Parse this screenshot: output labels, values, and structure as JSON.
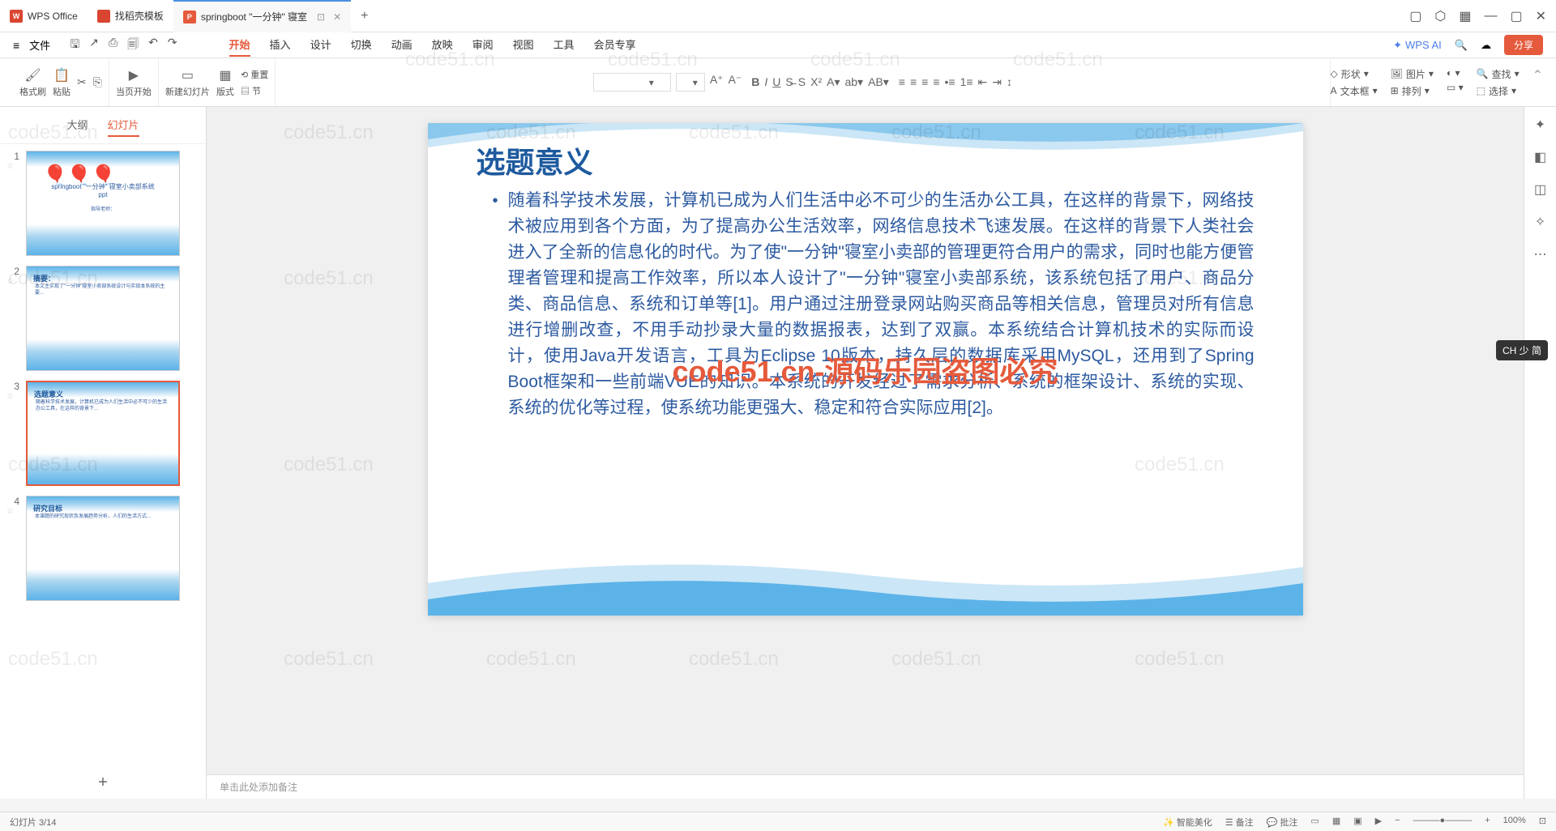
{
  "titlebar": {
    "tabs": [
      {
        "icon": "W",
        "label": "WPS Office"
      },
      {
        "icon": "D",
        "label": "找稻壳模板"
      },
      {
        "icon": "P",
        "label": "springboot \"一分钟\" 寝室"
      }
    ],
    "window_controls": {
      "min": "—",
      "max": "▢",
      "close": "✕"
    }
  },
  "menubar": {
    "file": "文件",
    "tabs": [
      "开始",
      "插入",
      "设计",
      "切换",
      "动画",
      "放映",
      "审阅",
      "视图",
      "工具",
      "会员专享"
    ],
    "active_tab": "开始",
    "wps_ai": "WPS AI",
    "share": "分享"
  },
  "ribbon": {
    "format_painter": "格式刷",
    "paste": "粘贴",
    "from_beginning": "当页开始",
    "new_slide": "新建幻灯片",
    "layout": "版式",
    "reset": "重置",
    "section": "节",
    "shape": "形状",
    "picture": "图片",
    "textbox": "文本框",
    "arrange": "排列",
    "find": "查找",
    "select": "选择"
  },
  "panel": {
    "tabs": {
      "outline": "大纲",
      "slides": "幻灯片"
    },
    "active": "幻灯片",
    "slides": [
      {
        "num": "1",
        "title": "springboot \"一分钟\" 寝室小卖部系统ppt",
        "subtitle": "指导老师："
      },
      {
        "num": "2",
        "title": "摘要："
      },
      {
        "num": "3",
        "title": "选题意义"
      },
      {
        "num": "4",
        "title": "研究目标"
      }
    ],
    "selected_index": 2
  },
  "slide": {
    "title": "选题意义",
    "body": "随着科学技术发展，计算机已成为人们生活中必不可少的生活办公工具，在这样的背景下，网络技术被应用到各个方面，为了提高办公生活效率，网络信息技术飞速发展。在这样的背景下人类社会进入了全新的信息化的时代。为了使\"一分钟\"寝室小卖部的管理更符合用户的需求，同时也能方便管理者管理和提高工作效率，所以本人设计了\"一分钟\"寝室小卖部系统，该系统包括了用户、商品分类、商品信息、系统和订单等[1]。用户通过注册登录网站购买商品等相关信息，管理员对所有信息进行增删改查，不用手动抄录大量的数据报表，达到了双赢。本系统结合计算机技术的实际而设计，使用Java开发语言，工具为Eclipse 10版本，持久层的数据库采用MySQL，还用到了Spring Boot框架和一些前端VUE的知识。本系统的开发经过了需求分析、系统的框架设计、系统的实现、系统的优化等过程，使系统功能更强大、稳定和符合实际应用[2]。"
  },
  "watermark_center": "code51.cn-源码乐园盗图必究",
  "watermark_repeat": "code51.cn",
  "notes_placeholder": "单击此处添加备注",
  "ime": "CH 少 简",
  "statusbar": {
    "left": "幻灯片 3/14",
    "smart_beautify": "智能美化",
    "notes": "备注",
    "comments": "批注",
    "zoom": "100%"
  }
}
